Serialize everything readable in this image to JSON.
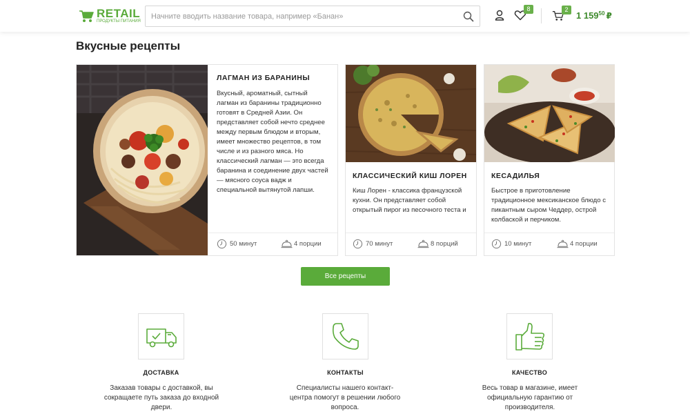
{
  "header": {
    "logo": {
      "title": "RETAIL",
      "subtitle": "ПРОДУКТЫ ПИТАНИЯ"
    },
    "search": {
      "placeholder": "Начните вводить название товара, например «Банан»",
      "value": ""
    },
    "icons": {
      "account": "user-icon",
      "favorites": "heart-icon",
      "cart": "cart-icon",
      "search": "search-icon"
    },
    "favorites_count": "8",
    "cart_count": "2",
    "cart_total": {
      "main": "1 159",
      "cents": "50",
      "currency": "₽"
    }
  },
  "recipes": {
    "title": "Вкусные рецепты",
    "items": [
      {
        "title": "ЛАГМАН ИЗ БАРАНИНЫ",
        "description": "Вкусный, ароматный, сытный лагман из баранины традиционно готовят в Средней Азии. Он представляет собой нечто среднее между первым блюдом и вторым, имеет множество рецептов, в том числе и из разного мяса. Но классический лагман — это всегда баранина и соединение двух частей — мясного соуса вадж и специальной вытянутой лапши.",
        "time": "50 минут",
        "portions": "4 порции"
      },
      {
        "title": "КЛАССИЧЕСКИЙ КИШ ЛОРЕН",
        "description": "Киш Лорен - классика французской кухни. Он представляет собой открытый пирог из песочного теста и",
        "time": "70 минут",
        "portions": "8 порций"
      },
      {
        "title": "КЕСАДИЛЬЯ",
        "description": "Быстрое в приготовление традиционное мексиканское блюдо с пикантным сыром Чеддер, острой колбаской и перчиком.",
        "time": "10 минут",
        "portions": "4 порции"
      }
    ],
    "all_button": "Все рецепты"
  },
  "features": [
    {
      "icon": "delivery-truck-icon",
      "title": "ДОСТАВКА",
      "text": "Заказав товары с доставкой, вы сокращаете путь заказа до входной двери."
    },
    {
      "icon": "phone-icon",
      "title": "КОНТАКТЫ",
      "text": "Специалисты нашего контакт-центра помогут в решении любого вопроса."
    },
    {
      "icon": "thumbs-up-icon",
      "title": "КАЧЕСТВО",
      "text": "Весь товар в магазине, имеет официальную гарантию от производителя."
    }
  ],
  "colors": {
    "accent": "#5aab3a",
    "accent_dark": "#3e8a2c",
    "border": "#e3e3e3",
    "text": "#222222"
  }
}
